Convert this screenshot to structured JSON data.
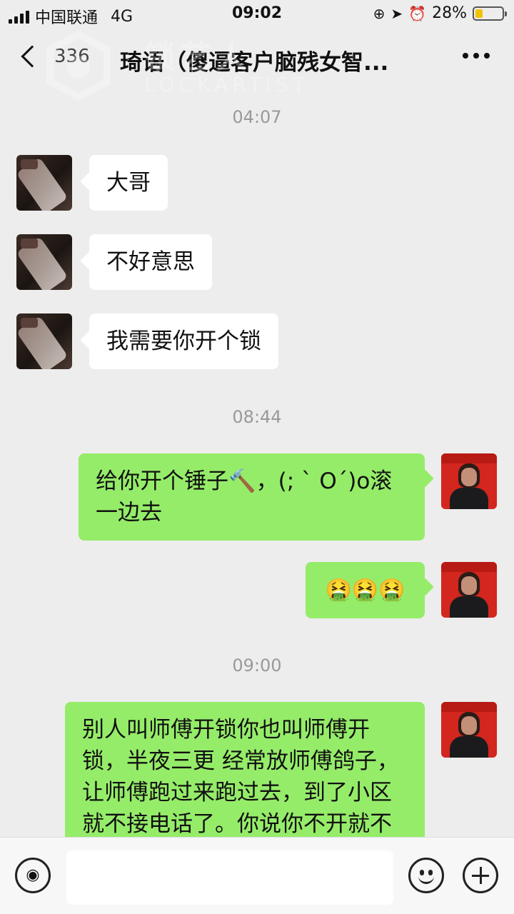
{
  "status_bar": {
    "carrier": "中国联通",
    "network": "4G",
    "time": "09:02",
    "battery_percent": "28%",
    "battery_level": 0.28
  },
  "header": {
    "unread_count": "336",
    "title": "琦语（傻逼客户脑残女智...",
    "more_icon": "more-dots-icon"
  },
  "watermark": {
    "logo_text": "锁艺人",
    "logo_subtext": "LOCKARTIST"
  },
  "messages": [
    {
      "type": "time",
      "text": "04:07"
    },
    {
      "type": "msg",
      "from": "friend",
      "text": "大哥"
    },
    {
      "type": "msg",
      "from": "friend",
      "text": "不好意思"
    },
    {
      "type": "msg",
      "from": "friend",
      "text": "我需要你开个锁"
    },
    {
      "type": "time",
      "text": "08:44"
    },
    {
      "type": "msg",
      "from": "me",
      "text": "给你开个锤子🔨，(; ` O´)o滚一边去"
    },
    {
      "type": "msg",
      "from": "me",
      "text": "🤮🤮🤮"
    },
    {
      "type": "time",
      "text": "09:00"
    },
    {
      "type": "msg",
      "from": "me",
      "text": "别人叫师傅开锁你也叫师傅开锁，半夜三更 经常放师傅鸽子，让师傅跑过来跑过去，到了小区就不接电话了。你说你不开就不开嘛，的好的，大门费"
    }
  ],
  "input_bar": {
    "voice_icon": "voice-icon",
    "placeholder": "",
    "emoji_icon": "emoji-icon",
    "plus_icon": "plus-icon"
  },
  "colors": {
    "background": "#ededed",
    "self_bubble": "#95ec69",
    "friend_bubble": "#ffffff",
    "battery_fill": "#f2c200"
  }
}
